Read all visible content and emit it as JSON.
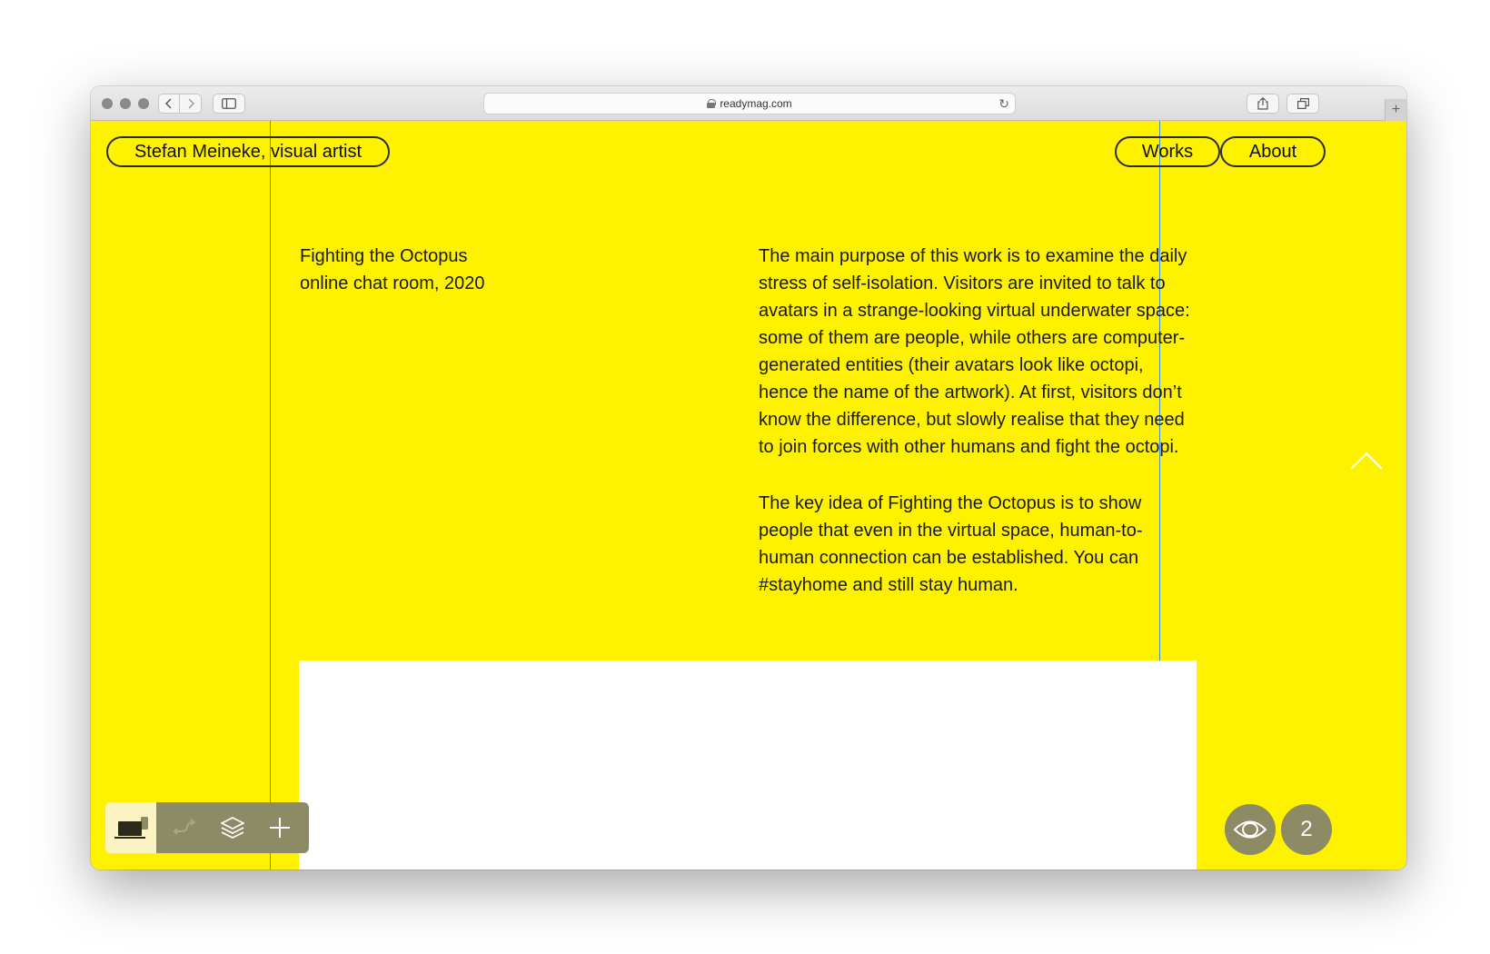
{
  "browser": {
    "url": "readymag.com"
  },
  "site": {
    "title": "Stefan Meineke, visual artist",
    "nav": [
      {
        "label": "Works"
      },
      {
        "label": "About"
      }
    ]
  },
  "artwork": {
    "caption_line1": "Fighting the Octopus",
    "caption_line2": "online chat room, 2020",
    "paragraph1": "The main purpose of this work is to examine the daily stress of self-isolation. Visitors are invited to talk to avatars in a strange-looking virtual underwater space: some of them are people, while others are computer-generated entities (their avatars look like octopi, hence the name of the artwork). At first, visitors don’t know the difference, but slowly realise that they need to join forces with other humans and fight the octopi.",
    "paragraph2": "The key idea of Fighting the Octopus is to show people that even in the virtual space, human-to-human connection can be established. You can #stayhome and still stay human."
  },
  "editor": {
    "page_number": "2",
    "icons": [
      "laptop-icon",
      "redirect-arrow-icon",
      "layers-icon",
      "plus-icon",
      "eye-icon",
      "chevron-up-icon"
    ]
  },
  "colors": {
    "page_background": "#fff200",
    "guide_line": "#3a8fdc",
    "editor_controls": "#8c8b66"
  }
}
